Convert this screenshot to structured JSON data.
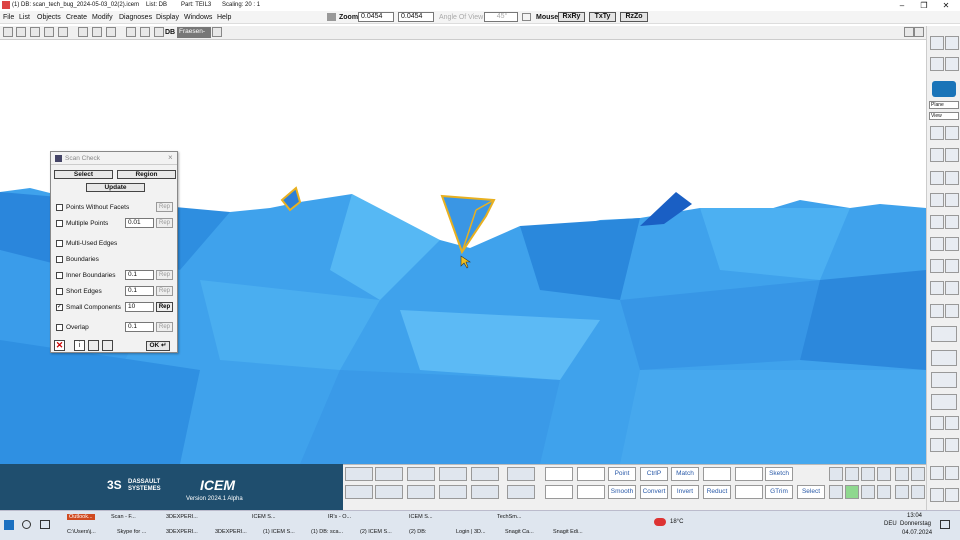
{
  "title_bar": {
    "window_title": "(1) DB: scan_tech_bug_2024-05-03_02(2).icem",
    "list": "List: DB",
    "part": "Part: TEIL3",
    "scaling": "Scaling: 20 : 1"
  },
  "menu": [
    "File",
    "List",
    "Objects",
    "Create",
    "Modify",
    "Diagnoses",
    "Display",
    "Windows",
    "Help"
  ],
  "view_controls": {
    "zoom_label": "Zoom",
    "zoom_value": "0.0454",
    "zoom_value2": "0.0454",
    "angle_label": "Angle Of View",
    "angle_value": "45°",
    "mouse_label": "Mouse",
    "mouse_buttons": [
      "RxRy",
      "TxTy",
      "RzZo"
    ]
  },
  "toolbar": {
    "db_label": "DB",
    "db_value": "Fraesen-"
  },
  "right_panel": {
    "dropdown1": "Plane",
    "dropdown2": "View"
  },
  "dialog": {
    "title": "Scan Check",
    "select_label": "Select",
    "region_label": "Region",
    "update_label": "Update",
    "rep_label": "Rep",
    "ok_label": "OK",
    "checks": [
      {
        "label": "Points Without Facets",
        "checked": false,
        "value": "",
        "rep_enabled": false
      },
      {
        "label": "Multiple Points",
        "checked": false,
        "value": "0.01",
        "rep_enabled": false
      },
      {
        "label": "Multi-Used Edges",
        "checked": false,
        "value": "",
        "rep_enabled": false
      },
      {
        "label": "Boundaries",
        "checked": false,
        "value": "",
        "rep_enabled": false
      },
      {
        "label": "Inner Boundaries",
        "checked": false,
        "value": "0.1",
        "rep_enabled": false
      },
      {
        "label": "Short Edges",
        "checked": false,
        "value": "0.1",
        "rep_enabled": false
      },
      {
        "label": "Small Components",
        "checked": true,
        "value": "10",
        "rep_enabled": true
      },
      {
        "label": "Overlap",
        "checked": false,
        "value": "0.1",
        "rep_enabled": false
      }
    ]
  },
  "brand": {
    "company_line1": "DASSAULT",
    "company_line2": "SYSTEMES",
    "product": "ICEM",
    "version": "Version 2024.1 Alpha"
  },
  "palette": {
    "row1": [
      "Point",
      "CtrlP",
      "Match",
      "Sketch"
    ],
    "row2": [
      "Smooth",
      "Convert",
      "Invert",
      "Reduct",
      "GTrim",
      "Select"
    ]
  },
  "taskbar": {
    "row1": [
      "Outlook...",
      "Scan - F...",
      "3DEXPERI...",
      "ICEM S...",
      "IR's - O...",
      "ICEM S...",
      "TechSm..."
    ],
    "row2": [
      "C:\\Users\\j...",
      "Skype for ...",
      "3DEXPERI...",
      "3DEXPERI...",
      "(1) ICEM S...",
      "(1) DB: sca...",
      "(2) ICEM S...",
      "(2) DB:",
      "Login | 3D...",
      "Snagit Ca...",
      "Snagit Edi..."
    ],
    "weather": "18°C",
    "lang": "DEU",
    "time": "13:04",
    "day": "Donnerstag",
    "date": "04.07.2024"
  },
  "colors": {
    "mesh_light": "#4fb0f0",
    "mesh_dark": "#1f74d6",
    "selection": "#e8b020",
    "brand_bg": "#1f4e6e",
    "palette_text": "#2a5aa8"
  }
}
